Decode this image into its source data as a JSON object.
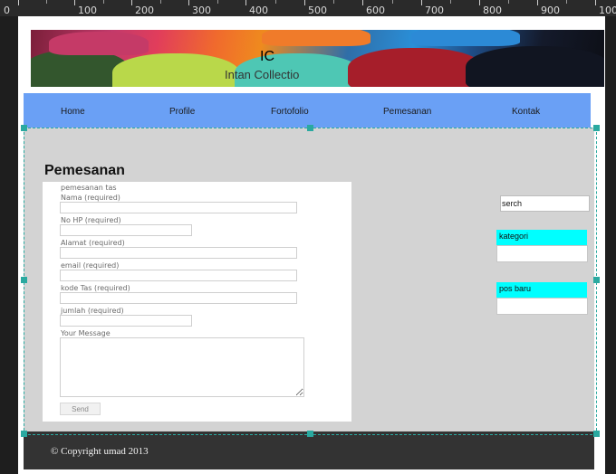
{
  "ruler": {
    "labels": [
      "0",
      "100",
      "200",
      "300",
      "400",
      "500",
      "600",
      "700",
      "800",
      "900",
      "100"
    ]
  },
  "banner": {
    "logo_short": "IC",
    "logo_name": "Intan Collectio"
  },
  "nav": {
    "items": [
      "Home",
      "Profile",
      "Fortofolio",
      "Pemesanan",
      "Kontak"
    ]
  },
  "page": {
    "title": "Pemesanan"
  },
  "form": {
    "heading": "pemesanan tas",
    "fields": [
      {
        "label": "Nama (required)",
        "value": ""
      },
      {
        "label": "No HP (required)",
        "value": ""
      },
      {
        "label": "Alamat (required)",
        "value": ""
      },
      {
        "label": "email (required)",
        "value": ""
      },
      {
        "label": "kode Tas (required)",
        "value": ""
      },
      {
        "label": "jumlah (required)",
        "value": ""
      }
    ],
    "message_label": "Your Message",
    "send_label": "Send"
  },
  "sidebar": {
    "search_text": "serch",
    "kategori_label": "kategori",
    "pos_baru_label": "pos baru"
  },
  "footer": {
    "copyright": "© Copyright umad 2013"
  },
  "colors": {
    "nav": "#6aa0f5",
    "content": "#d3d3d3",
    "footer": "#333333",
    "sidebar_accent": "#00ffff",
    "selection": "#2aa9a0"
  }
}
